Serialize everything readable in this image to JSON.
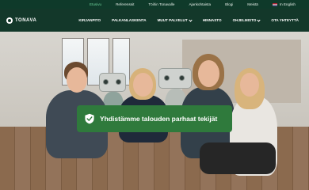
{
  "topbar": {
    "items": [
      {
        "label": "Etusivu",
        "active": true
      },
      {
        "label": "Referenssit"
      },
      {
        "label": "Töihin Tonavalle"
      },
      {
        "label": "Ajankohtaista"
      },
      {
        "label": "Blogi"
      },
      {
        "label": "Meistä"
      },
      {
        "label": "In English",
        "icon": "uk-flag-icon"
      }
    ]
  },
  "brand": {
    "name": "TONAVA"
  },
  "menu": {
    "items": [
      {
        "label": "KIRJANPITO",
        "dropdown": false
      },
      {
        "label": "PALKANLASKENTA",
        "dropdown": false
      },
      {
        "label": "MUUT PALVELUT",
        "dropdown": true
      },
      {
        "label": "HINNASTO",
        "dropdown": false
      },
      {
        "label": "OHJELMISTO",
        "dropdown": true
      },
      {
        "label": "OTA YHTEYTTÄ",
        "dropdown": false
      }
    ]
  },
  "hero": {
    "cta_label": "Yhdistämme talouden parhaat tekijät",
    "cta_icon": "shield-check-icon"
  },
  "colors": {
    "topbar_bg": "#0f3a2a",
    "navbar_bg": "#13382a",
    "active_link": "#6fd29b",
    "cta_bg": "#2f7a3c"
  }
}
